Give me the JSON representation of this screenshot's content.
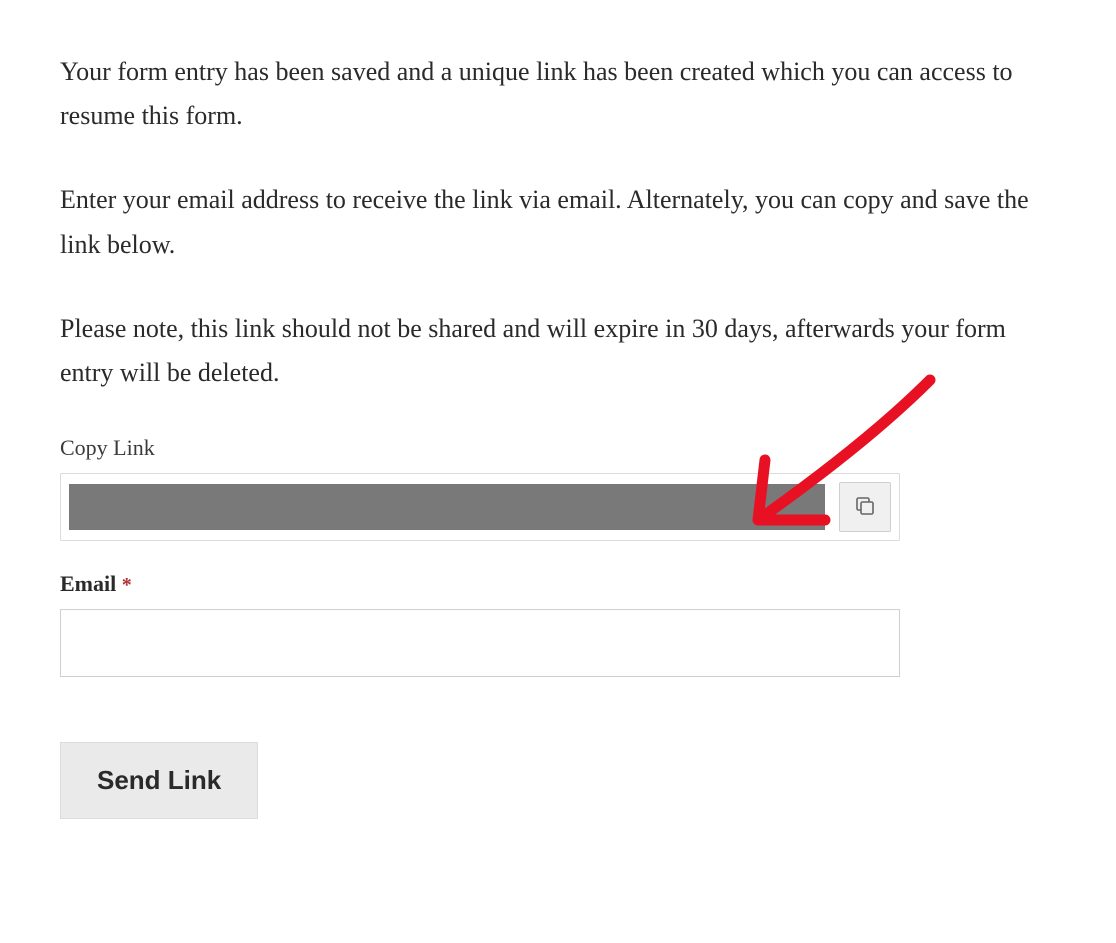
{
  "paragraphs": {
    "p1": "Your form entry has been saved and a unique link has been created which you can access to resume this form.",
    "p2": "Enter your email address to receive the link via email. Alternately, you can copy and save the link below.",
    "p3": "Please note, this link should not be shared and will expire in 30 days, afterwards your form entry will be deleted."
  },
  "fields": {
    "copy_link_label": "Copy Link",
    "email_label": "Email",
    "required_mark": "*",
    "email_value": ""
  },
  "buttons": {
    "send": "Send Link"
  },
  "annotation": {
    "arrow_color": "#e81123"
  }
}
